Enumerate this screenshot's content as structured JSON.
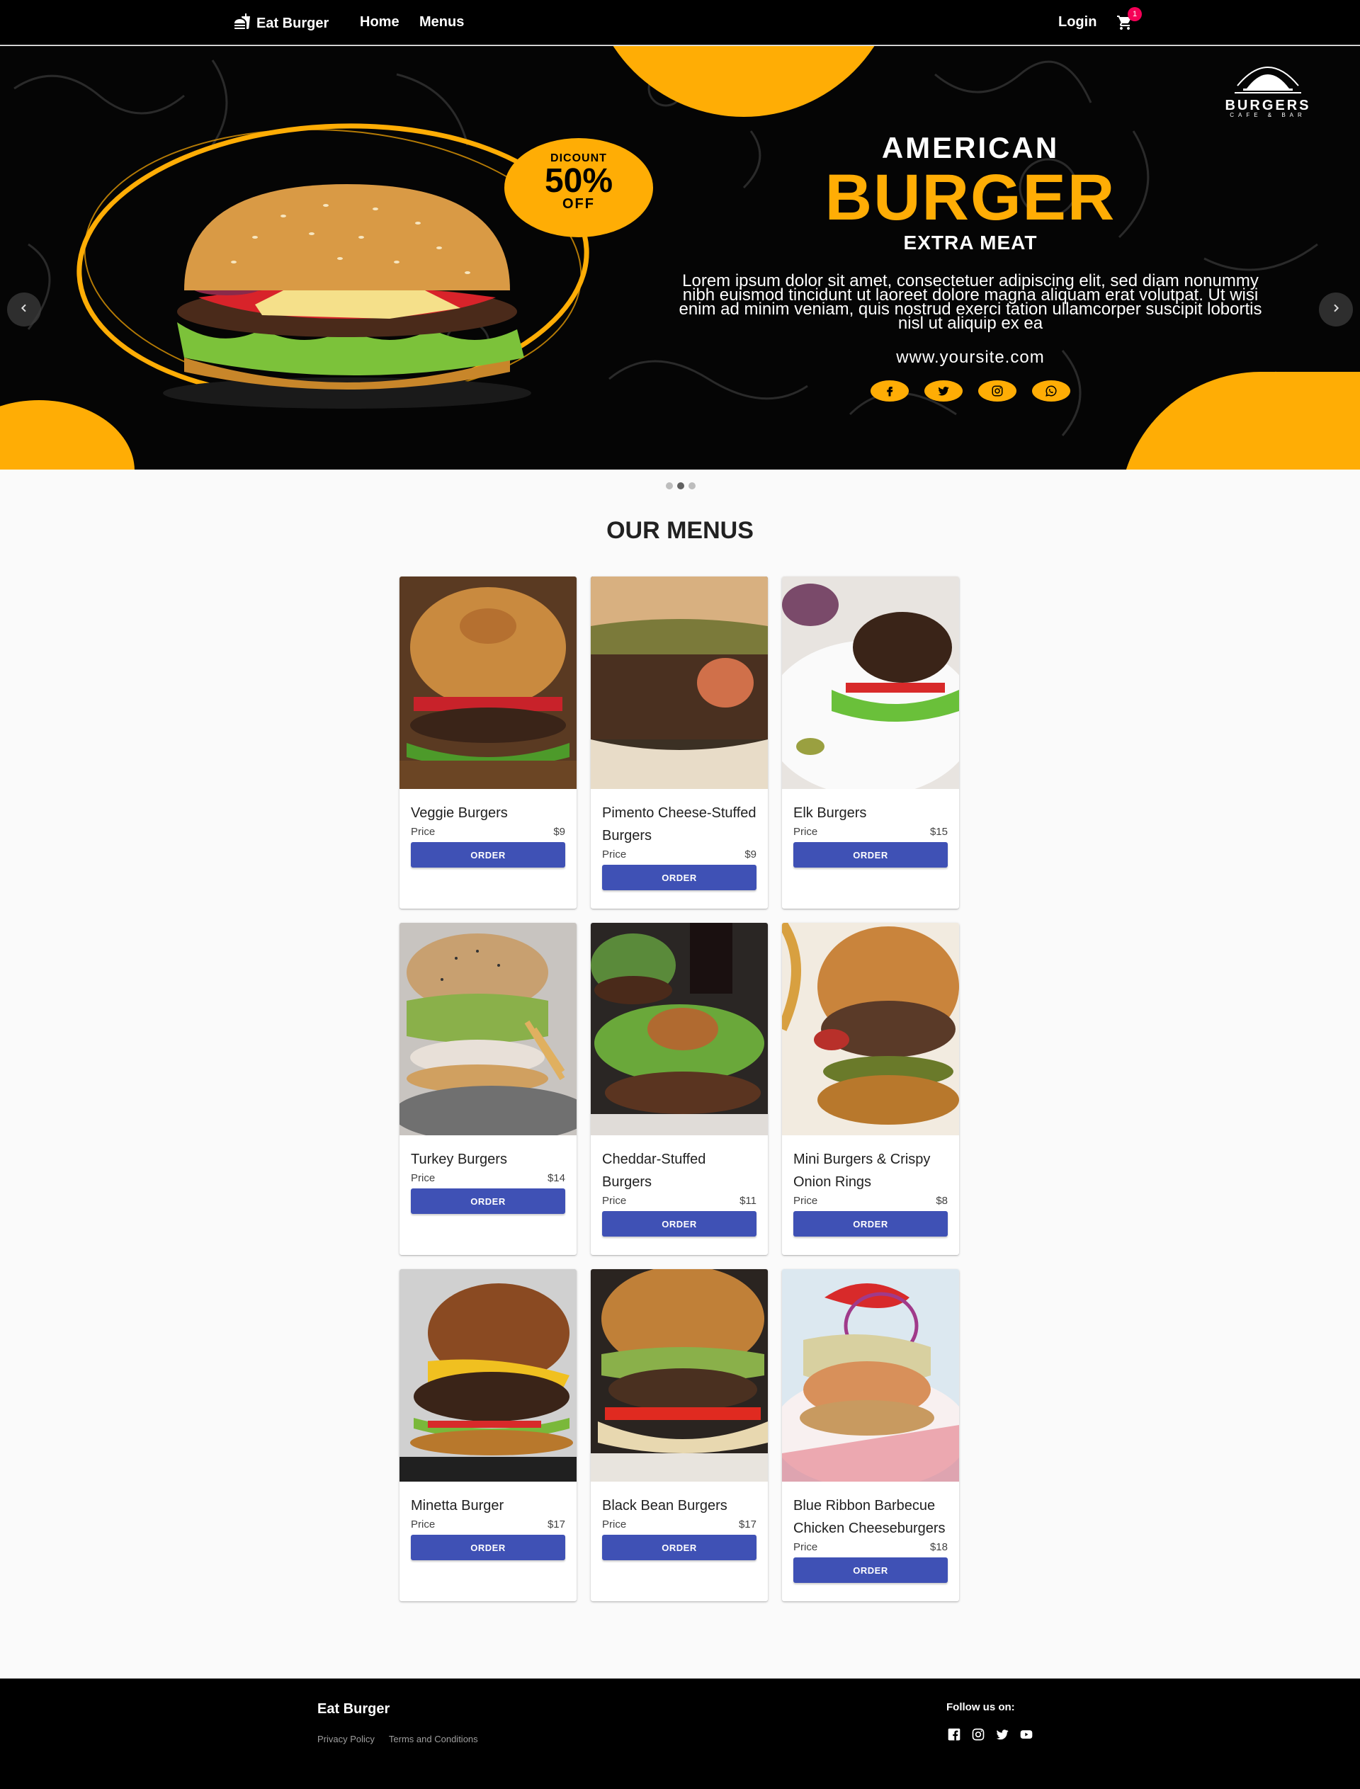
{
  "navbar": {
    "brand": "Eat Burger",
    "links": [
      "Home",
      "Menus"
    ],
    "login": "Login",
    "cart_count": "1"
  },
  "hero": {
    "discount_top": "DICOUNT",
    "discount_value": "50%",
    "discount_bottom": "OFF",
    "line1": "AMERICAN",
    "line2": "BURGER",
    "line3": "EXTRA MEAT",
    "lorem": "Lorem ipsum dolor sit amet, consectetuer adipiscing elit, sed diam nonummy nibh euismod tincidunt ut laoreet dolore magna aliquam erat volutpat. Ut wisi enim ad minim veniam, quis nostrud exerci tation ullamcorper suscipit lobortis nisl ut aliquip ex ea",
    "website": "www.yoursite.com",
    "logo_title": "BURGERS",
    "logo_sub": "CAFE & BAR",
    "accent": "#ffad05",
    "slides": 3,
    "active_slide": 2
  },
  "menus": {
    "title": "OUR MENUS",
    "price_label": "Price",
    "order_label": "ORDER",
    "button_color": "#3f51b5",
    "items": [
      {
        "name": "Veggie Burgers",
        "price": "$9"
      },
      {
        "name": "Pimento Cheese-Stuffed Burgers",
        "price": "$9"
      },
      {
        "name": "Elk Burgers",
        "price": "$15"
      },
      {
        "name": "Turkey Burgers",
        "price": "$14"
      },
      {
        "name": "Cheddar-Stuffed Burgers",
        "price": "$11"
      },
      {
        "name": "Mini Burgers & Crispy Onion Rings",
        "price": "$8"
      },
      {
        "name": "Minetta Burger",
        "price": "$17"
      },
      {
        "name": "Black Bean Burgers",
        "price": "$17"
      },
      {
        "name": "Blue Ribbon Barbecue Chicken Cheeseburgers",
        "price": "$18"
      }
    ]
  },
  "footer": {
    "brand": "Eat Burger",
    "links": [
      "Privacy Policy",
      "Terms and Conditions"
    ],
    "follow": "Follow us on:",
    "social_icons": [
      "facebook-icon",
      "instagram-icon",
      "twitter-icon",
      "youtube-icon"
    ]
  }
}
